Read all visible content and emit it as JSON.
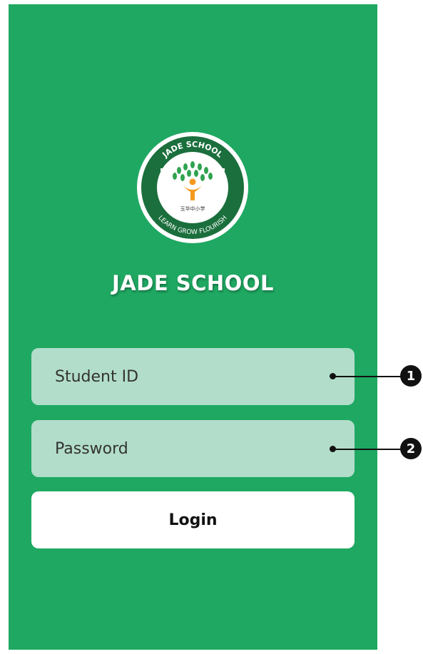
{
  "app": {
    "school_name": "JADE SCHOOL",
    "logo": {
      "ring_top_text": "JADE SCHOOL",
      "ring_bottom_text": "LEARN GROW FLOURISH",
      "chinese_text": "玉华中小学"
    }
  },
  "form": {
    "student_id_placeholder": "Student ID",
    "password_placeholder": "Password",
    "login_label": "Login"
  },
  "callouts": [
    {
      "number": "1"
    },
    {
      "number": "2"
    }
  ],
  "colors": {
    "background": "#1fa862",
    "field": "#b2ddca",
    "button": "#ffffff",
    "logo_ring": "#1b6f3d",
    "accent_orange": "#f39a1e"
  }
}
